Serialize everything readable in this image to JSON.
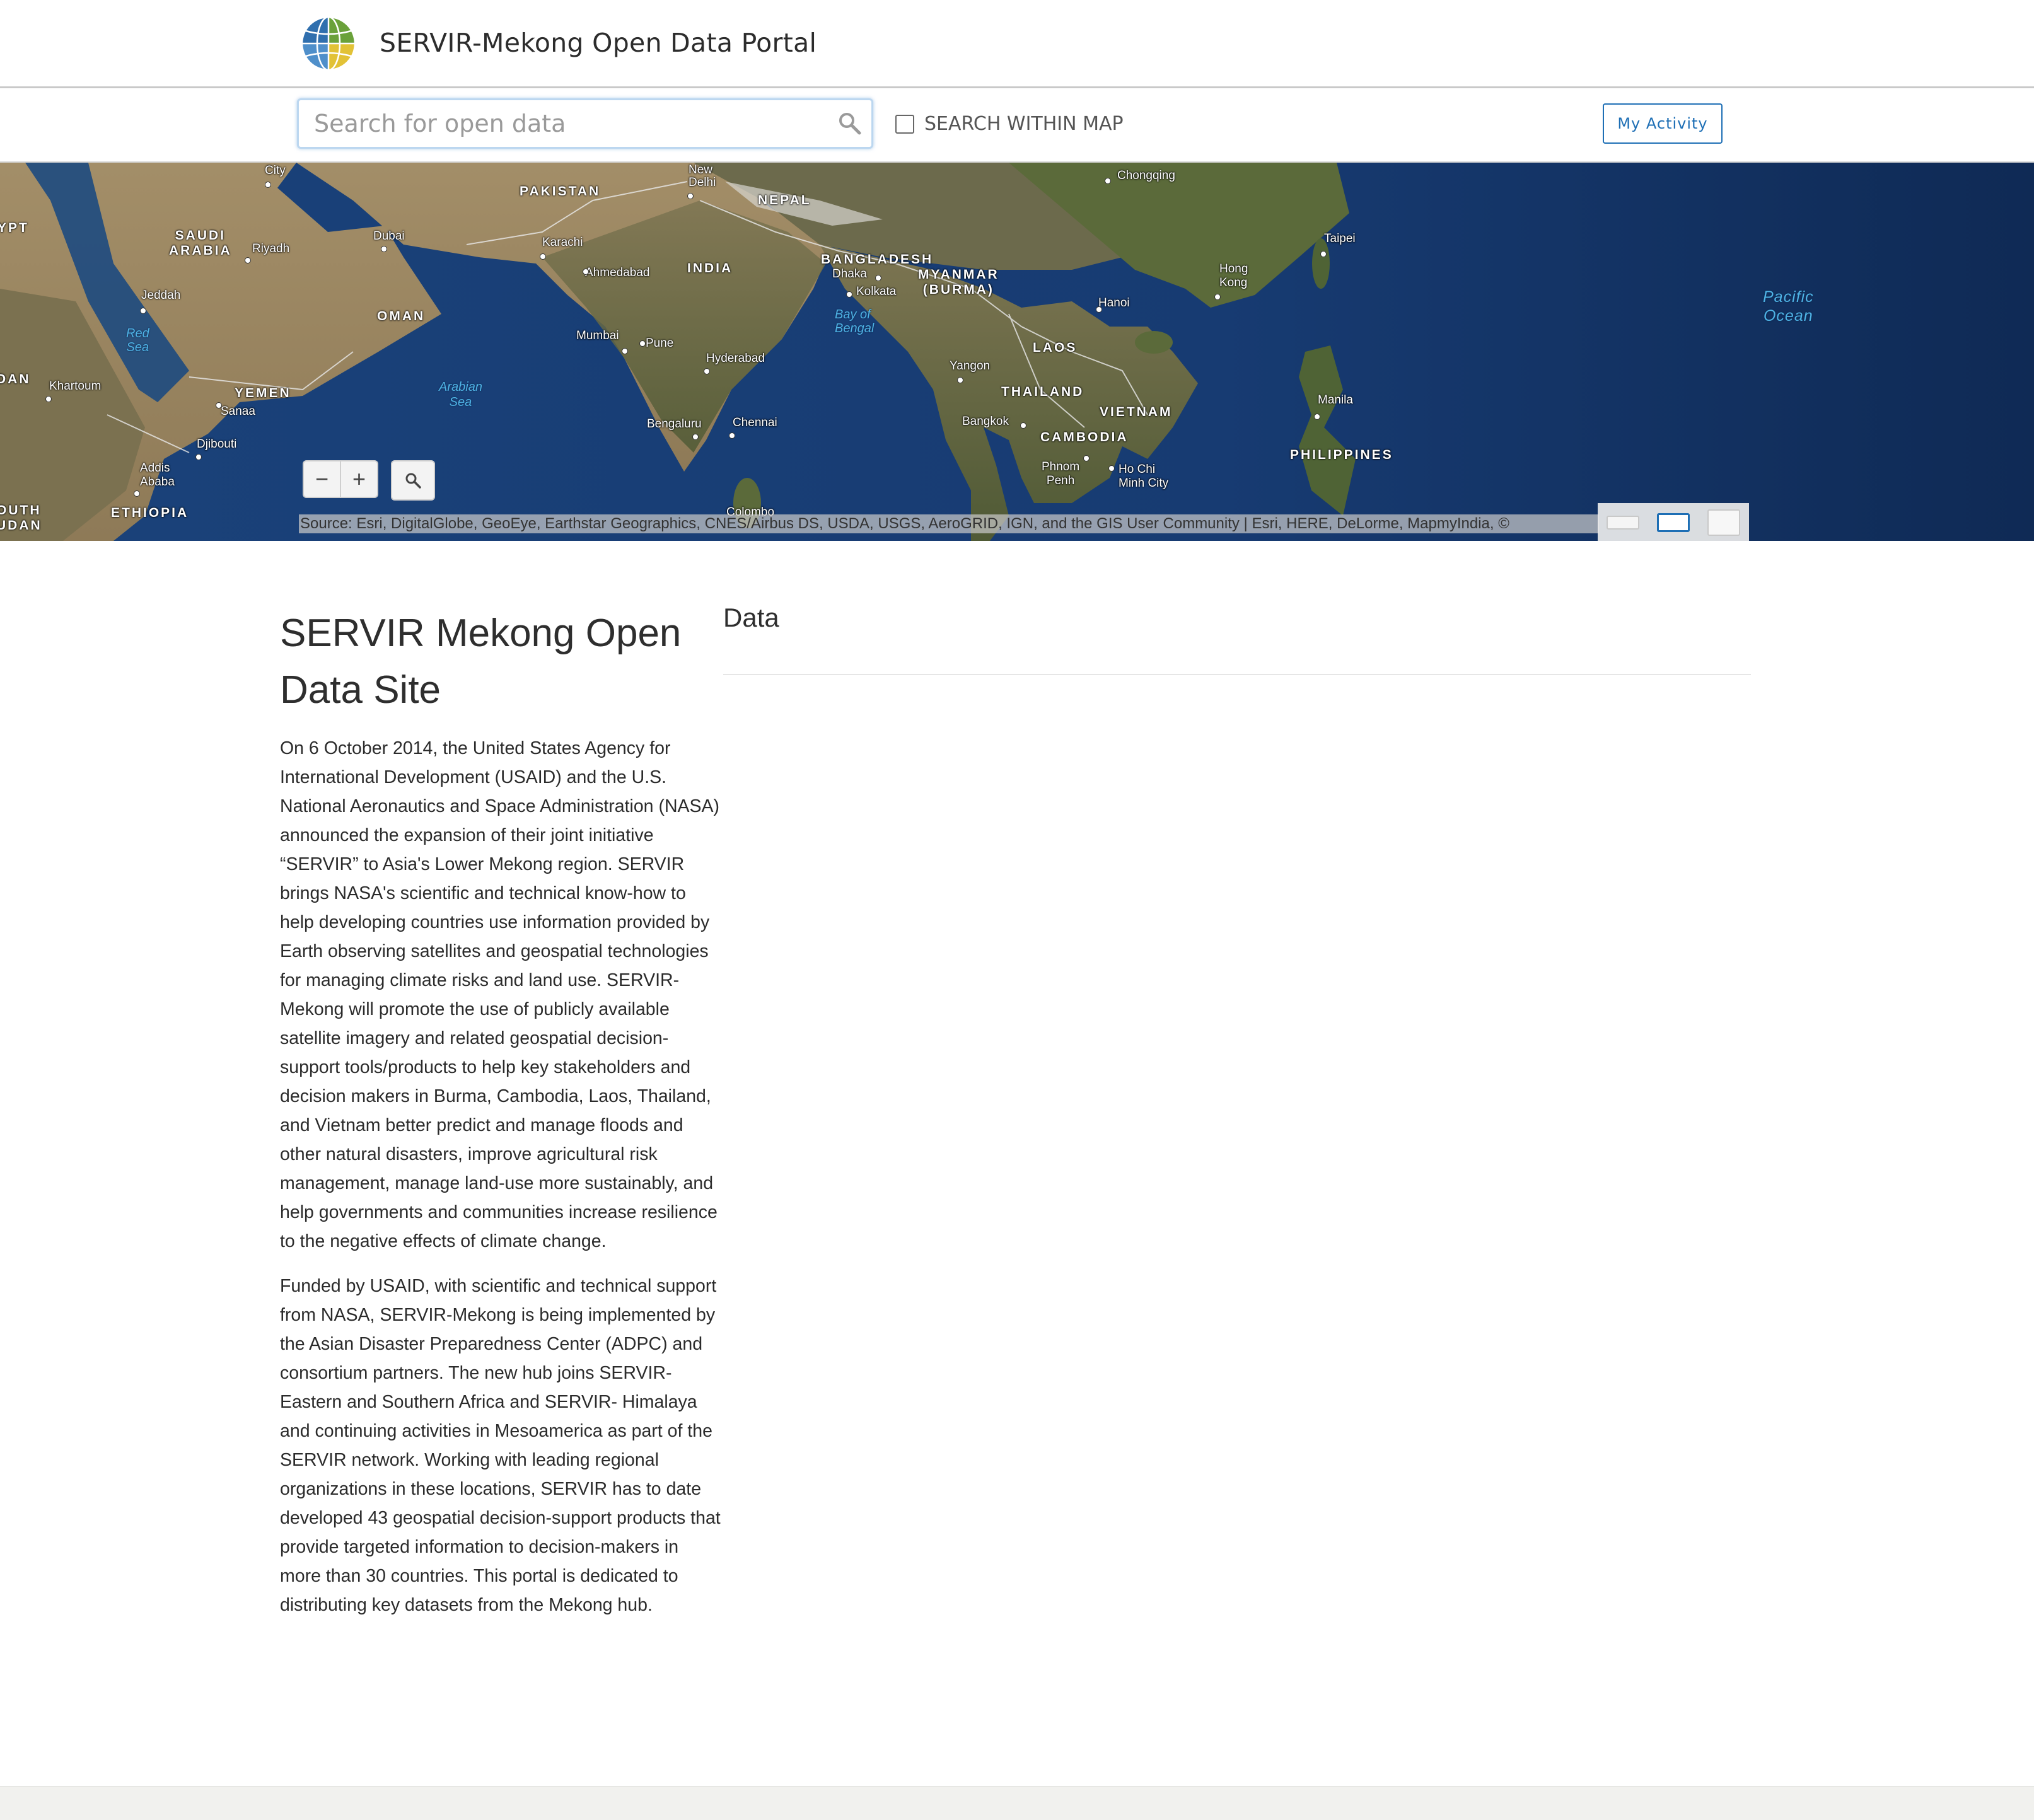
{
  "header": {
    "site_title": "SERVIR-Mekong Open Data Portal"
  },
  "toolbar": {
    "search_placeholder": "Search for open data",
    "search_value": "",
    "within_map_label": "SEARCH WITHIN MAP",
    "within_map_checked": false,
    "activity_button": "My Activity"
  },
  "map": {
    "countries": [
      {
        "id": "egypt",
        "text": "YPT"
      },
      {
        "id": "saudi",
        "text": "SAUDI\nARABIA"
      },
      {
        "id": "pakistan",
        "text": "PAKISTAN"
      },
      {
        "id": "nepal",
        "text": "NEPAL"
      },
      {
        "id": "india",
        "text": "INDIA"
      },
      {
        "id": "bangladesh",
        "text": "BANGLADESH"
      },
      {
        "id": "myanmar",
        "text": "MYANMAR\n(BURMA)"
      },
      {
        "id": "oman",
        "text": "OMAN"
      },
      {
        "id": "yemen",
        "text": "YEMEN"
      },
      {
        "id": "sudan",
        "text": "DAN"
      },
      {
        "id": "laos",
        "text": "LAOS"
      },
      {
        "id": "thailand",
        "text": "THAILAND"
      },
      {
        "id": "vietnam",
        "text": "VIETNAM"
      },
      {
        "id": "cambodia",
        "text": "CAMBODIA"
      },
      {
        "id": "philippines",
        "text": "PHILIPPINES"
      },
      {
        "id": "ethiopia",
        "text": "ETHIOPIA"
      },
      {
        "id": "southsudan",
        "text": "OUTH\nUDAN"
      }
    ],
    "cities": [
      {
        "id": "city",
        "text": "City"
      },
      {
        "id": "riyadh",
        "text": "Riyadh"
      },
      {
        "id": "dubai",
        "text": "Dubai"
      },
      {
        "id": "karachi",
        "text": "Karachi"
      },
      {
        "id": "newdelhi",
        "text": "New\nDelhi"
      },
      {
        "id": "chongqing",
        "text": "Chongqing"
      },
      {
        "id": "jeddah",
        "text": "Jeddah"
      },
      {
        "id": "ahmedabad",
        "text": "Ahmedabad"
      },
      {
        "id": "dhaka",
        "text": "Dhaka"
      },
      {
        "id": "kolkata",
        "text": "Kolkata"
      },
      {
        "id": "hongkong",
        "text": "Hong\nKong"
      },
      {
        "id": "taipei",
        "text": "Taipei"
      },
      {
        "id": "hanoi",
        "text": "Hanoi"
      },
      {
        "id": "mumbai",
        "text": "Mumbai"
      },
      {
        "id": "pune",
        "text": "Pune"
      },
      {
        "id": "hyderabad",
        "text": "Hyderabad"
      },
      {
        "id": "yangon",
        "text": "Yangon"
      },
      {
        "id": "khartoum",
        "text": "Khartoum"
      },
      {
        "id": "sanaa",
        "text": "Sanaa"
      },
      {
        "id": "bengaluru",
        "text": "Bengaluru"
      },
      {
        "id": "chennai",
        "text": "Chennai"
      },
      {
        "id": "bangkok",
        "text": "Bangkok"
      },
      {
        "id": "manila",
        "text": "Manila"
      },
      {
        "id": "djibouti",
        "text": "Djibouti"
      },
      {
        "id": "phnompenh",
        "text": "Phnom\nPenh"
      },
      {
        "id": "hochiminh",
        "text": "Ho Chi\nMinh City"
      },
      {
        "id": "addis",
        "text": "Addis\nAbaba"
      },
      {
        "id": "colombo",
        "text": "Colombo"
      }
    ],
    "waters": [
      {
        "id": "redsea",
        "text": "Red\nSea"
      },
      {
        "id": "arabiansea",
        "text": "Arabian\nSea"
      },
      {
        "id": "bengal",
        "text": "Bay of\nBengal"
      }
    ],
    "oceans": [
      {
        "id": "pacific",
        "text": "Pacific\nOcean"
      }
    ],
    "zoom_out": "−",
    "zoom_in": "+",
    "attribution": "Source: Esri, DigitalGlobe, GeoEye, Earthstar Geographics, CNES/Airbus DS, USDA, USGS, AeroGRID, IGN, and the GIS User Community | Esri, HERE, DeLorme, MapmyIndia, ©"
  },
  "content": {
    "title": "SERVIR Mekong Open Data Site",
    "paragraph1": "On 6 October 2014, the United States Agency for International Development (USAID) and the U.S. National Aeronautics and Space Administration (NASA) announced the expansion of their joint initiative “SERVIR” to Asia's Lower Mekong region. SERVIR brings NASA's scientific and technical know-how to help developing countries use information provided by Earth observing satellites and geospatial technologies for managing climate risks and land use. SERVIR-Mekong will promote the use of publicly available satellite imagery and related geospatial decision-support tools/products to help key stakeholders and decision makers in Burma, Cambodia, Laos, Thailand, and Vietnam better predict and manage floods and other natural disasters, improve agricultural risk management, manage land-use more sustainably, and help governments and communities increase resilience to the negative effects of climate change.",
    "paragraph2": "Funded by USAID, with scientific and technical support from NASA, SERVIR-Mekong is being implemented by the Asian Disaster Preparedness Center (ADPC) and consortium partners. The new hub joins SERVIR-Eastern and Southern Africa and SERVIR- Himalaya and continuing activities in Mesoamerica as part of the SERVIR network. Working with leading regional organizations in these locations, SERVIR has to date developed 43 geospatial decision-support products that provide targeted information to decision-makers in more than 30 countries. This portal is dedicated to distributing key datasets from the Mekong hub.",
    "data_heading": "Data"
  },
  "colors": {
    "accent": "#1e6fb5",
    "ocean": "#173b6e",
    "land": "#8a7a57",
    "footer": "#f1f1ee"
  }
}
